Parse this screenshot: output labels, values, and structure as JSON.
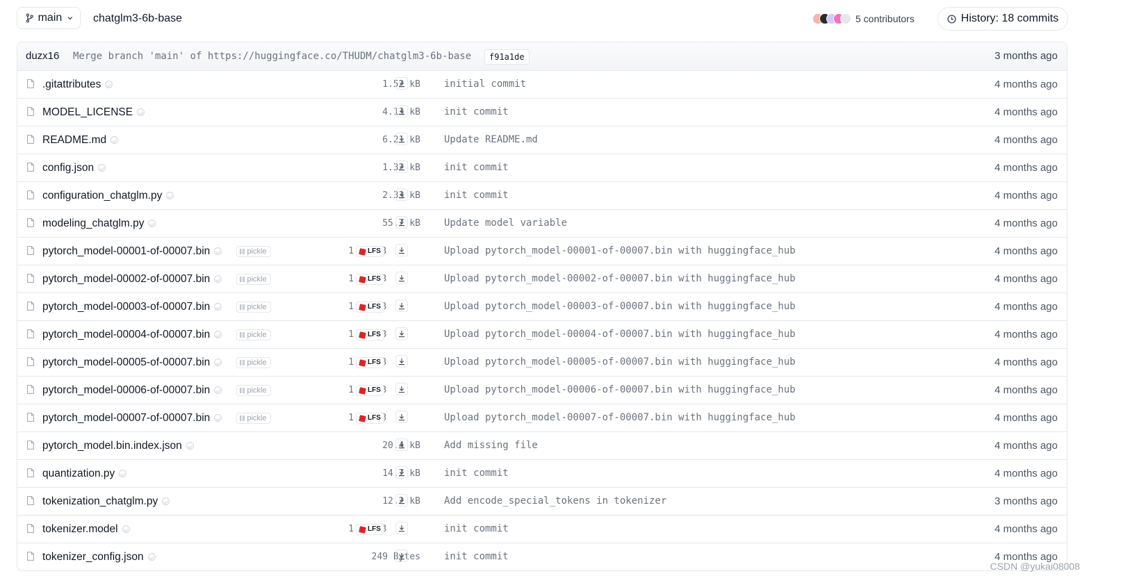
{
  "branch": {
    "name": "main"
  },
  "repo": {
    "path": "chatglm3-6b-base"
  },
  "contributors": {
    "label": "5 contributors",
    "avatar_colors": [
      "#f3b6a8",
      "#2b2b2b",
      "#d8c6ff",
      "#f472b6",
      "#e5e7eb"
    ]
  },
  "history": {
    "label": "History: 18 commits"
  },
  "last_commit": {
    "author": "duzx16",
    "message": "Merge branch 'main' of https://huggingface.co/THUDM/chatglm3-6b-base",
    "sha": "f91a1de",
    "time": "3 months ago"
  },
  "files": [
    {
      "name": ".gitattributes",
      "size": "1.52 kB",
      "lfs": false,
      "pickle": false,
      "commit": "initial commit",
      "time": "4 months ago"
    },
    {
      "name": "MODEL_LICENSE",
      "size": "4.13 kB",
      "lfs": false,
      "pickle": false,
      "commit": "init commit",
      "time": "4 months ago"
    },
    {
      "name": "README.md",
      "size": "6.21 kB",
      "lfs": false,
      "pickle": false,
      "commit": "Update README.md",
      "time": "4 months ago"
    },
    {
      "name": "config.json",
      "size": "1.32 kB",
      "lfs": false,
      "pickle": false,
      "commit": "init commit",
      "time": "4 months ago"
    },
    {
      "name": "configuration_chatglm.py",
      "size": "2.33 kB",
      "lfs": false,
      "pickle": false,
      "commit": "init commit",
      "time": "4 months ago"
    },
    {
      "name": "modeling_chatglm.py",
      "size": "55.7 kB",
      "lfs": false,
      "pickle": false,
      "commit": "Update model variable",
      "time": "4 months ago"
    },
    {
      "name": "pytorch_model-00001-of-00007.bin",
      "size": "1.83 GB",
      "lfs": true,
      "pickle": true,
      "commit": "Upload pytorch_model-00001-of-00007.bin with huggingface_hub",
      "time": "4 months ago"
    },
    {
      "name": "pytorch_model-00002-of-00007.bin",
      "size": "1.97 GB",
      "lfs": true,
      "pickle": true,
      "commit": "Upload pytorch_model-00002-of-00007.bin with huggingface_hub",
      "time": "4 months ago"
    },
    {
      "name": "pytorch_model-00003-of-00007.bin",
      "size": "1.93 GB",
      "lfs": true,
      "pickle": true,
      "commit": "Upload pytorch_model-00003-of-00007.bin with huggingface_hub",
      "time": "4 months ago"
    },
    {
      "name": "pytorch_model-00004-of-00007.bin",
      "size": "1.82 GB",
      "lfs": true,
      "pickle": true,
      "commit": "Upload pytorch_model-00004-of-00007.bin with huggingface_hub",
      "time": "4 months ago"
    },
    {
      "name": "pytorch_model-00005-of-00007.bin",
      "size": "1.97 GB",
      "lfs": true,
      "pickle": true,
      "commit": "Upload pytorch_model-00005-of-00007.bin with huggingface_hub",
      "time": "4 months ago"
    },
    {
      "name": "pytorch_model-00006-of-00007.bin",
      "size": "1.93 GB",
      "lfs": true,
      "pickle": true,
      "commit": "Upload pytorch_model-00006-of-00007.bin with huggingface_hub",
      "time": "4 months ago"
    },
    {
      "name": "pytorch_model-00007-of-00007.bin",
      "size": "1.05 GB",
      "lfs": true,
      "pickle": true,
      "commit": "Upload pytorch_model-00007-of-00007.bin with huggingface_hub",
      "time": "4 months ago"
    },
    {
      "name": "pytorch_model.bin.index.json",
      "size": "20.4 kB",
      "lfs": false,
      "pickle": false,
      "commit": "Add missing file",
      "time": "4 months ago"
    },
    {
      "name": "quantization.py",
      "size": "14.7 kB",
      "lfs": false,
      "pickle": false,
      "commit": "init commit",
      "time": "4 months ago"
    },
    {
      "name": "tokenization_chatglm.py",
      "size": "12.2 kB",
      "lfs": false,
      "pickle": false,
      "commit": "Add encode_special_tokens in tokenizer",
      "time": "3 months ago"
    },
    {
      "name": "tokenizer.model",
      "size": "1.02 MB",
      "lfs": true,
      "pickle": false,
      "commit": "init commit",
      "time": "4 months ago"
    },
    {
      "name": "tokenizer_config.json",
      "size": "249 Bytes",
      "lfs": false,
      "pickle": false,
      "commit": "init commit",
      "time": "4 months ago"
    }
  ],
  "labels": {
    "pickle": "pickle",
    "lfs": "LFS"
  },
  "watermark": "CSDN @yukai08008"
}
